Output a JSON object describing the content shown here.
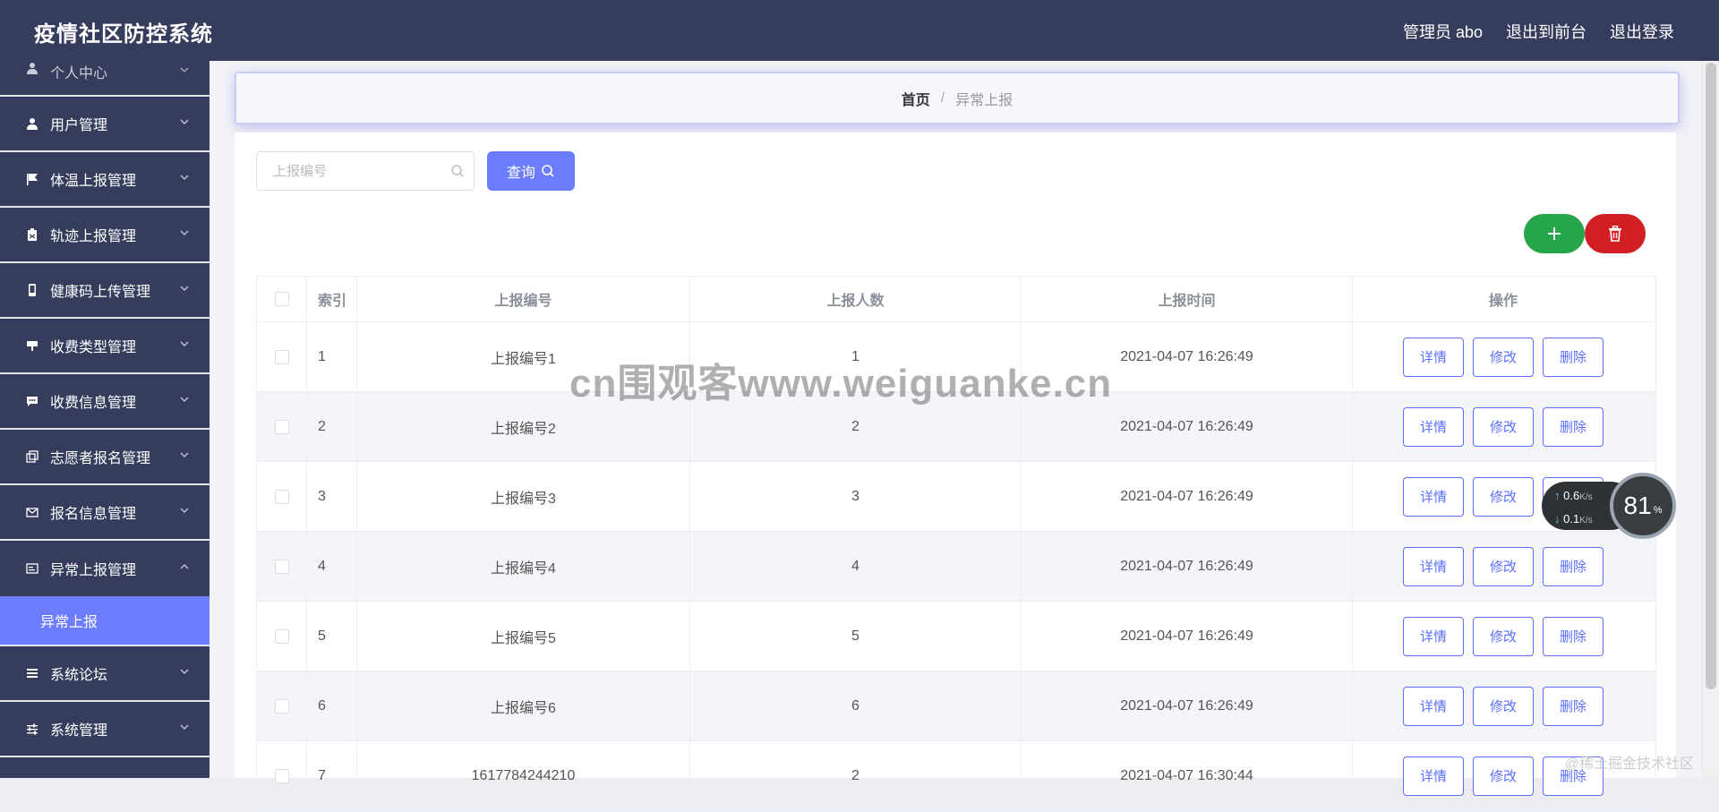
{
  "app": {
    "title": "疫情社区防控系统"
  },
  "header": {
    "user": "管理员 abo",
    "to_front": "退出到前台",
    "logout": "退出登录"
  },
  "sidebar": {
    "items": [
      {
        "label": "个人中心",
        "icon": "person-icon"
      },
      {
        "label": "用户管理",
        "icon": "user-icon"
      },
      {
        "label": "体温上报管理",
        "icon": "flag-icon"
      },
      {
        "label": "轨迹上报管理",
        "icon": "clipboard-icon"
      },
      {
        "label": "健康码上传管理",
        "icon": "phone-icon"
      },
      {
        "label": "收费类型管理",
        "icon": "tag-icon"
      },
      {
        "label": "收费信息管理",
        "icon": "chat-icon"
      },
      {
        "label": "志愿者报名管理",
        "icon": "copy-icon"
      },
      {
        "label": "报名信息管理",
        "icon": "mail-icon"
      },
      {
        "label": "异常上报管理",
        "icon": "card-icon"
      },
      {
        "label": "系统论坛",
        "icon": "list-icon"
      },
      {
        "label": "系统管理",
        "icon": "sliders-icon"
      }
    ],
    "active_sub": "异常上报"
  },
  "breadcrumb": {
    "home": "首页",
    "separator": "/",
    "current": "异常上报"
  },
  "search": {
    "placeholder": "上报编号",
    "value": "",
    "button": "查询"
  },
  "table": {
    "headers": {
      "index": "索引",
      "code": "上报编号",
      "count": "上报人数",
      "time": "上报时间",
      "action": "操作"
    },
    "rows": [
      {
        "index": "1",
        "code": "上报编号1",
        "count": "1",
        "time": "2021-04-07 16:26:49"
      },
      {
        "index": "2",
        "code": "上报编号2",
        "count": "2",
        "time": "2021-04-07 16:26:49"
      },
      {
        "index": "3",
        "code": "上报编号3",
        "count": "3",
        "time": "2021-04-07 16:26:49"
      },
      {
        "index": "4",
        "code": "上报编号4",
        "count": "4",
        "time": "2021-04-07 16:26:49"
      },
      {
        "index": "5",
        "code": "上报编号5",
        "count": "5",
        "time": "2021-04-07 16:26:49"
      },
      {
        "index": "6",
        "code": "上报编号6",
        "count": "6",
        "time": "2021-04-07 16:26:49"
      },
      {
        "index": "7",
        "code": "1617784244210",
        "count": "2",
        "time": "2021-04-07 16:30:44"
      }
    ],
    "actions": {
      "detail": "详情",
      "edit": "修改",
      "delete": "删除"
    }
  },
  "overlay": {
    "watermark": "cn围观客www.weiguanke.cn",
    "upload_speed": "0.6",
    "download_speed": "0.1",
    "speed_unit": "K/s",
    "percent": "81",
    "percent_unit": "%",
    "corner_text": "@稀土掘金技术社区"
  },
  "colors": {
    "sidebar": "#353c5c",
    "accent": "#6b7cff",
    "add": "#27a54a",
    "delete": "#d21f24"
  }
}
